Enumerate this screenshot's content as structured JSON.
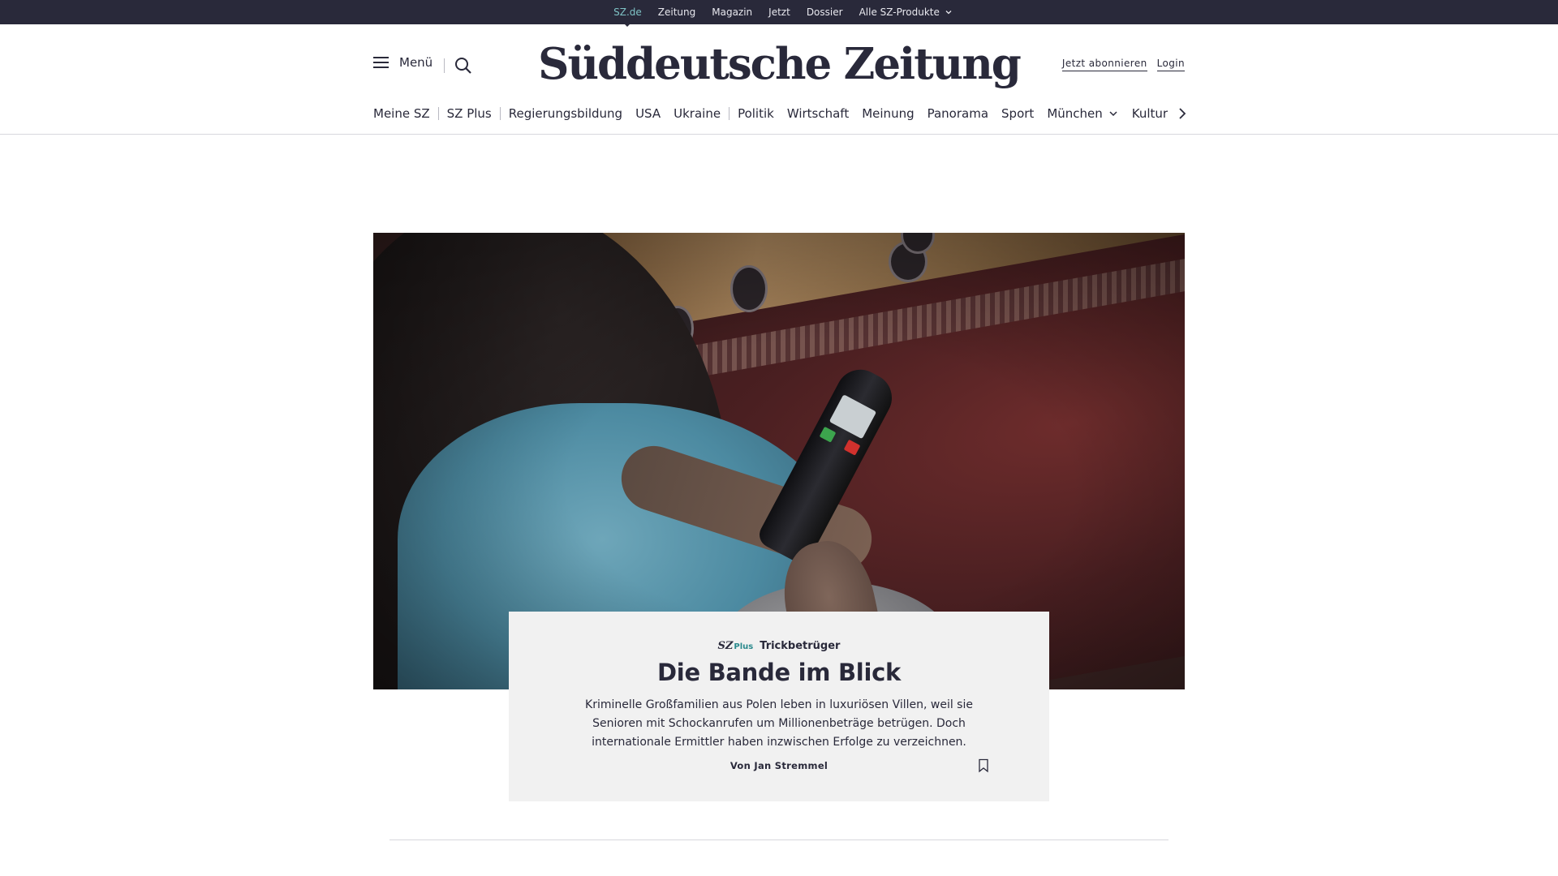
{
  "topbar": {
    "links": [
      {
        "label": "SZ.de"
      },
      {
        "label": "Zeitung"
      },
      {
        "label": "Magazin"
      },
      {
        "label": "Jetzt"
      },
      {
        "label": "Dossier"
      },
      {
        "label": "Alle SZ-Produkte"
      }
    ]
  },
  "header": {
    "menu_label": "Menü",
    "logo_text": "Süddeutsche Zeitung",
    "subscribe_label": "Jetzt abonnieren",
    "login_label": "Login"
  },
  "nav": {
    "items": [
      "Meine SZ",
      "SZ Plus",
      "Regierungsbildung",
      "USA",
      "Ukraine",
      "Politik",
      "Wirtschaft",
      "Meinung",
      "Panorama",
      "Sport",
      "München",
      "Kultur"
    ]
  },
  "teaser": {
    "badge_sz": "SZ",
    "badge_plus": "Plus",
    "kicker": "Trickbetrüger",
    "headline": "Die Bande im Blick",
    "text": "Kriminelle Großfamilien aus Polen leben in luxuriösen Villen, weil sie Senioren mit Schockanrufen um Millionenbeträge betrügen. Doch internationale Ermittler haben inzwischen Erfolge zu verzeichnen.",
    "author": "Von Jan Stremmel"
  },
  "colors": {
    "topbar_bg": "#29293a",
    "active_link": "#7fc3c6",
    "text": "#29293a",
    "card_bg": "#f1f1f1",
    "plus_accent": "#2a8a8d"
  },
  "icons": [
    "hamburger-icon",
    "search-icon",
    "chevron-down-icon",
    "chevron-right-icon",
    "bookmark-icon"
  ]
}
